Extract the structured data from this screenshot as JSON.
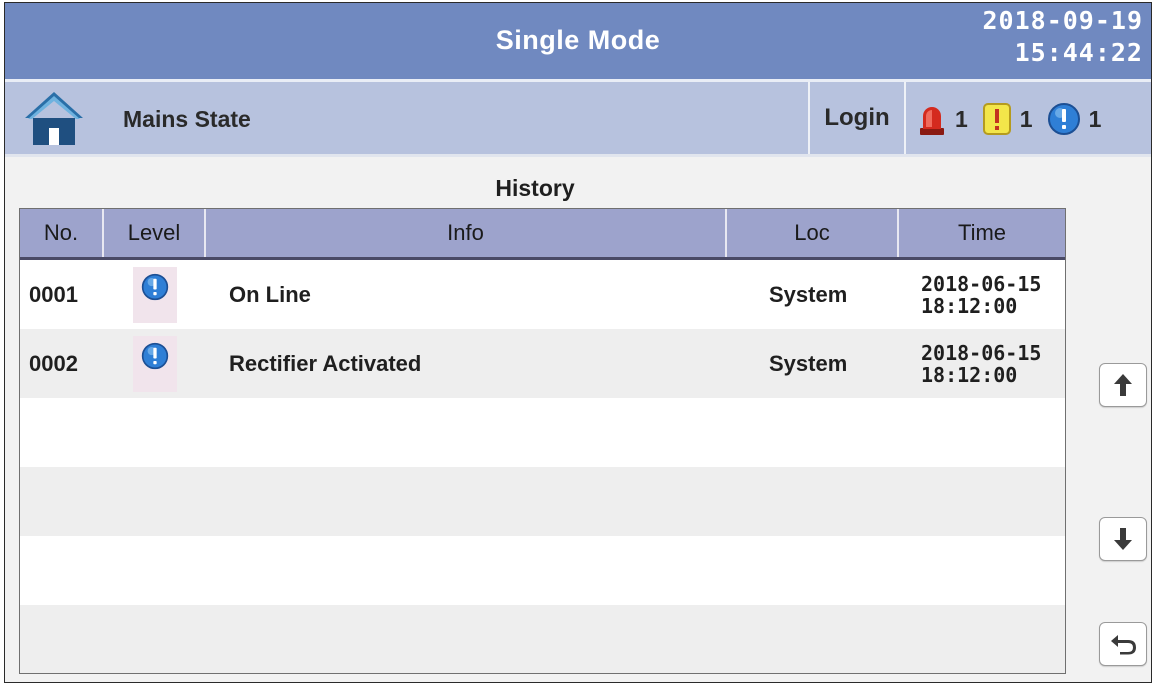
{
  "header": {
    "title": "Single Mode",
    "date": "2018-09-19",
    "time": "15:44:22"
  },
  "subbar": {
    "home_icon": "home-icon",
    "page_label": "Mains State",
    "login_label": "Login",
    "alarms": [
      {
        "icon": "red-siren-icon",
        "count": "1"
      },
      {
        "icon": "yellow-warning-icon",
        "count": "1"
      },
      {
        "icon": "blue-info-icon",
        "count": "1"
      }
    ]
  },
  "history": {
    "title": "History",
    "columns": [
      "No.",
      "Level",
      "Info",
      "Loc",
      "Time"
    ],
    "rows": [
      {
        "no": "0001",
        "level_icon": "blue-info-icon",
        "info": "On Line",
        "loc": "System",
        "date": "2018-06-15",
        "time": "18:12:00"
      },
      {
        "no": "0002",
        "level_icon": "blue-info-icon",
        "info": "Rectifier Activated",
        "loc": "System",
        "date": "2018-06-15",
        "time": "18:12:00"
      }
    ]
  },
  "buttons": {
    "scroll_up": "arrow-up-icon",
    "scroll_down": "arrow-down-icon",
    "back": "back-arrow-icon"
  },
  "colors": {
    "title_bar": "#7089c0",
    "sub_bar": "#b7c2de",
    "table_header": "#9da3cc",
    "info_icon": "#2f7fd6",
    "warning_icon": "#f3e64a",
    "alarm_icon": "#d42a1e"
  }
}
